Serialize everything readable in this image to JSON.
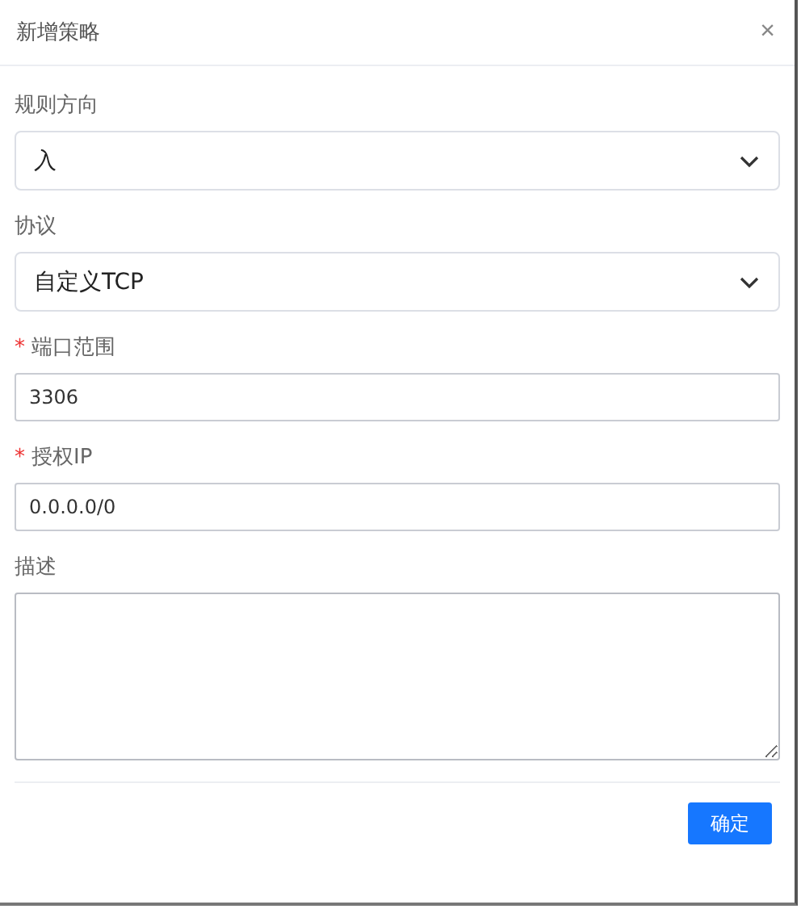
{
  "dialog": {
    "title": "新增策略",
    "close": "×"
  },
  "fields": [
    {
      "kind": "select",
      "label": "规则方向",
      "value": "入"
    },
    {
      "kind": "select",
      "label": "协议",
      "value": "自定义TCP"
    },
    {
      "kind": "input",
      "required_mark": "*",
      "label": "端口范围",
      "value": "3306"
    },
    {
      "kind": "input",
      "required_mark": "*",
      "label": "授权IP",
      "value": "0.0.0.0/0"
    },
    {
      "kind": "textarea",
      "label": "描述"
    }
  ],
  "buttons": [
    "确定"
  ]
}
